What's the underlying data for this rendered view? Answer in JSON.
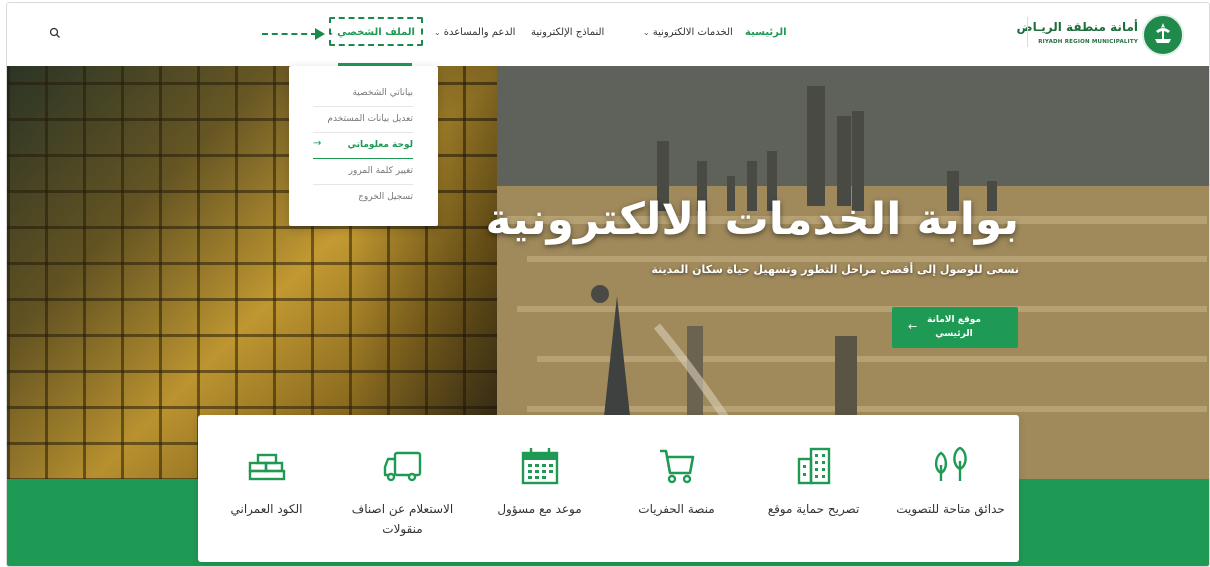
{
  "header": {
    "logo_ar": "أمانة منطقة الريـاض",
    "logo_en": "RIYADH REGION MUNICIPALITY",
    "nav": {
      "home": "الرئيسية",
      "eservices": "الخدمات الالكترونية",
      "eforms": "النماذج الإلكترونية",
      "support": "الدعم والمساعدة",
      "profile": "الملف الشخصي"
    }
  },
  "dropdown": {
    "items": [
      {
        "label": "بياناتي الشخصية",
        "active": false
      },
      {
        "label": "تعديل بيانات المستخدم",
        "active": false
      },
      {
        "label": "لوحة معلوماتي",
        "active": true
      },
      {
        "label": "تغيير كلمة المرور",
        "active": false
      },
      {
        "label": "تسجيل الخروج",
        "active": false
      }
    ]
  },
  "hero": {
    "title": "بوابة الخدمات الالكترونية",
    "subtitle": "نسعى للوصول إلى أقصى مراحل التطور وتسهيل حياة سكان المدينة",
    "button_label": "موقع الامانة الرئيسي"
  },
  "services": [
    {
      "label": "حدائق متاحة للتصويت",
      "icon": "trees-icon"
    },
    {
      "label": "تصريح حماية موقع",
      "icon": "building-icon"
    },
    {
      "label": "منصة الحفريات",
      "icon": "cart-icon"
    },
    {
      "label": "موعد مع مسؤول",
      "icon": "calendar-icon"
    },
    {
      "label": "الاستعلام عن اصناف منقولات",
      "icon": "truck-icon"
    },
    {
      "label": "الكود العمراني",
      "icon": "bricks-icon"
    }
  ],
  "colors": {
    "brand_green": "#1f9a55",
    "annotation_green": "#1a8a4a"
  }
}
